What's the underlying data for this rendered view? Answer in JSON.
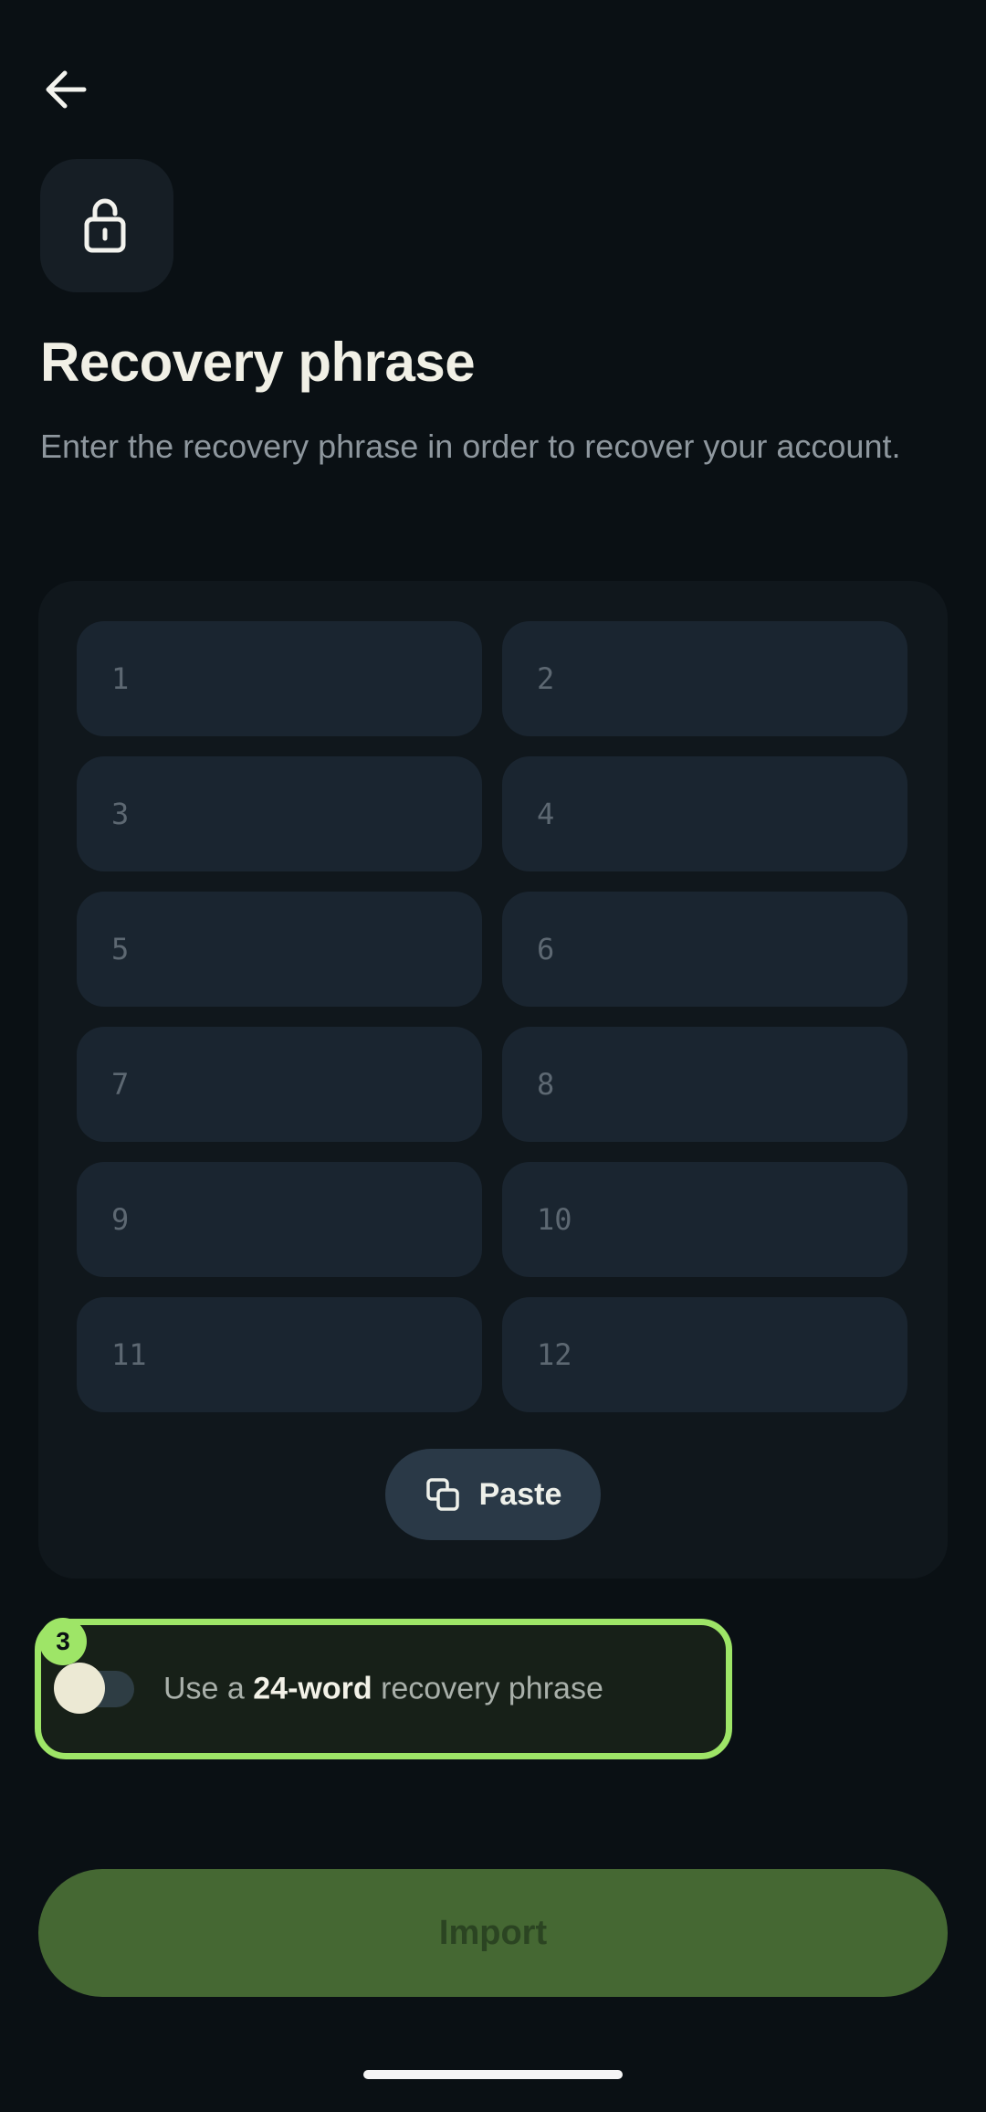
{
  "header": {
    "back_icon": "arrow-left-icon"
  },
  "hero": {
    "icon": "lock-open-icon",
    "title": "Recovery phrase",
    "subtitle": "Enter the recovery phrase in order to recover your account."
  },
  "phrase": {
    "inputs": [
      {
        "placeholder": "1",
        "value": ""
      },
      {
        "placeholder": "2",
        "value": ""
      },
      {
        "placeholder": "3",
        "value": ""
      },
      {
        "placeholder": "4",
        "value": ""
      },
      {
        "placeholder": "5",
        "value": ""
      },
      {
        "placeholder": "6",
        "value": ""
      },
      {
        "placeholder": "7",
        "value": ""
      },
      {
        "placeholder": "8",
        "value": ""
      },
      {
        "placeholder": "9",
        "value": ""
      },
      {
        "placeholder": "10",
        "value": ""
      },
      {
        "placeholder": "11",
        "value": ""
      },
      {
        "placeholder": "12",
        "value": ""
      }
    ],
    "paste_label": "Paste",
    "paste_icon": "copy-icon"
  },
  "word_count_toggle": {
    "badge": "3",
    "enabled": false,
    "label_prefix": "Use a ",
    "label_bold": "24-word",
    "label_suffix": " recovery phrase"
  },
  "import_label": "Import",
  "colors": {
    "background": "#0a1014",
    "accent": "#9ee567",
    "import_button": "#456833",
    "input_fill": "#1a2530"
  }
}
